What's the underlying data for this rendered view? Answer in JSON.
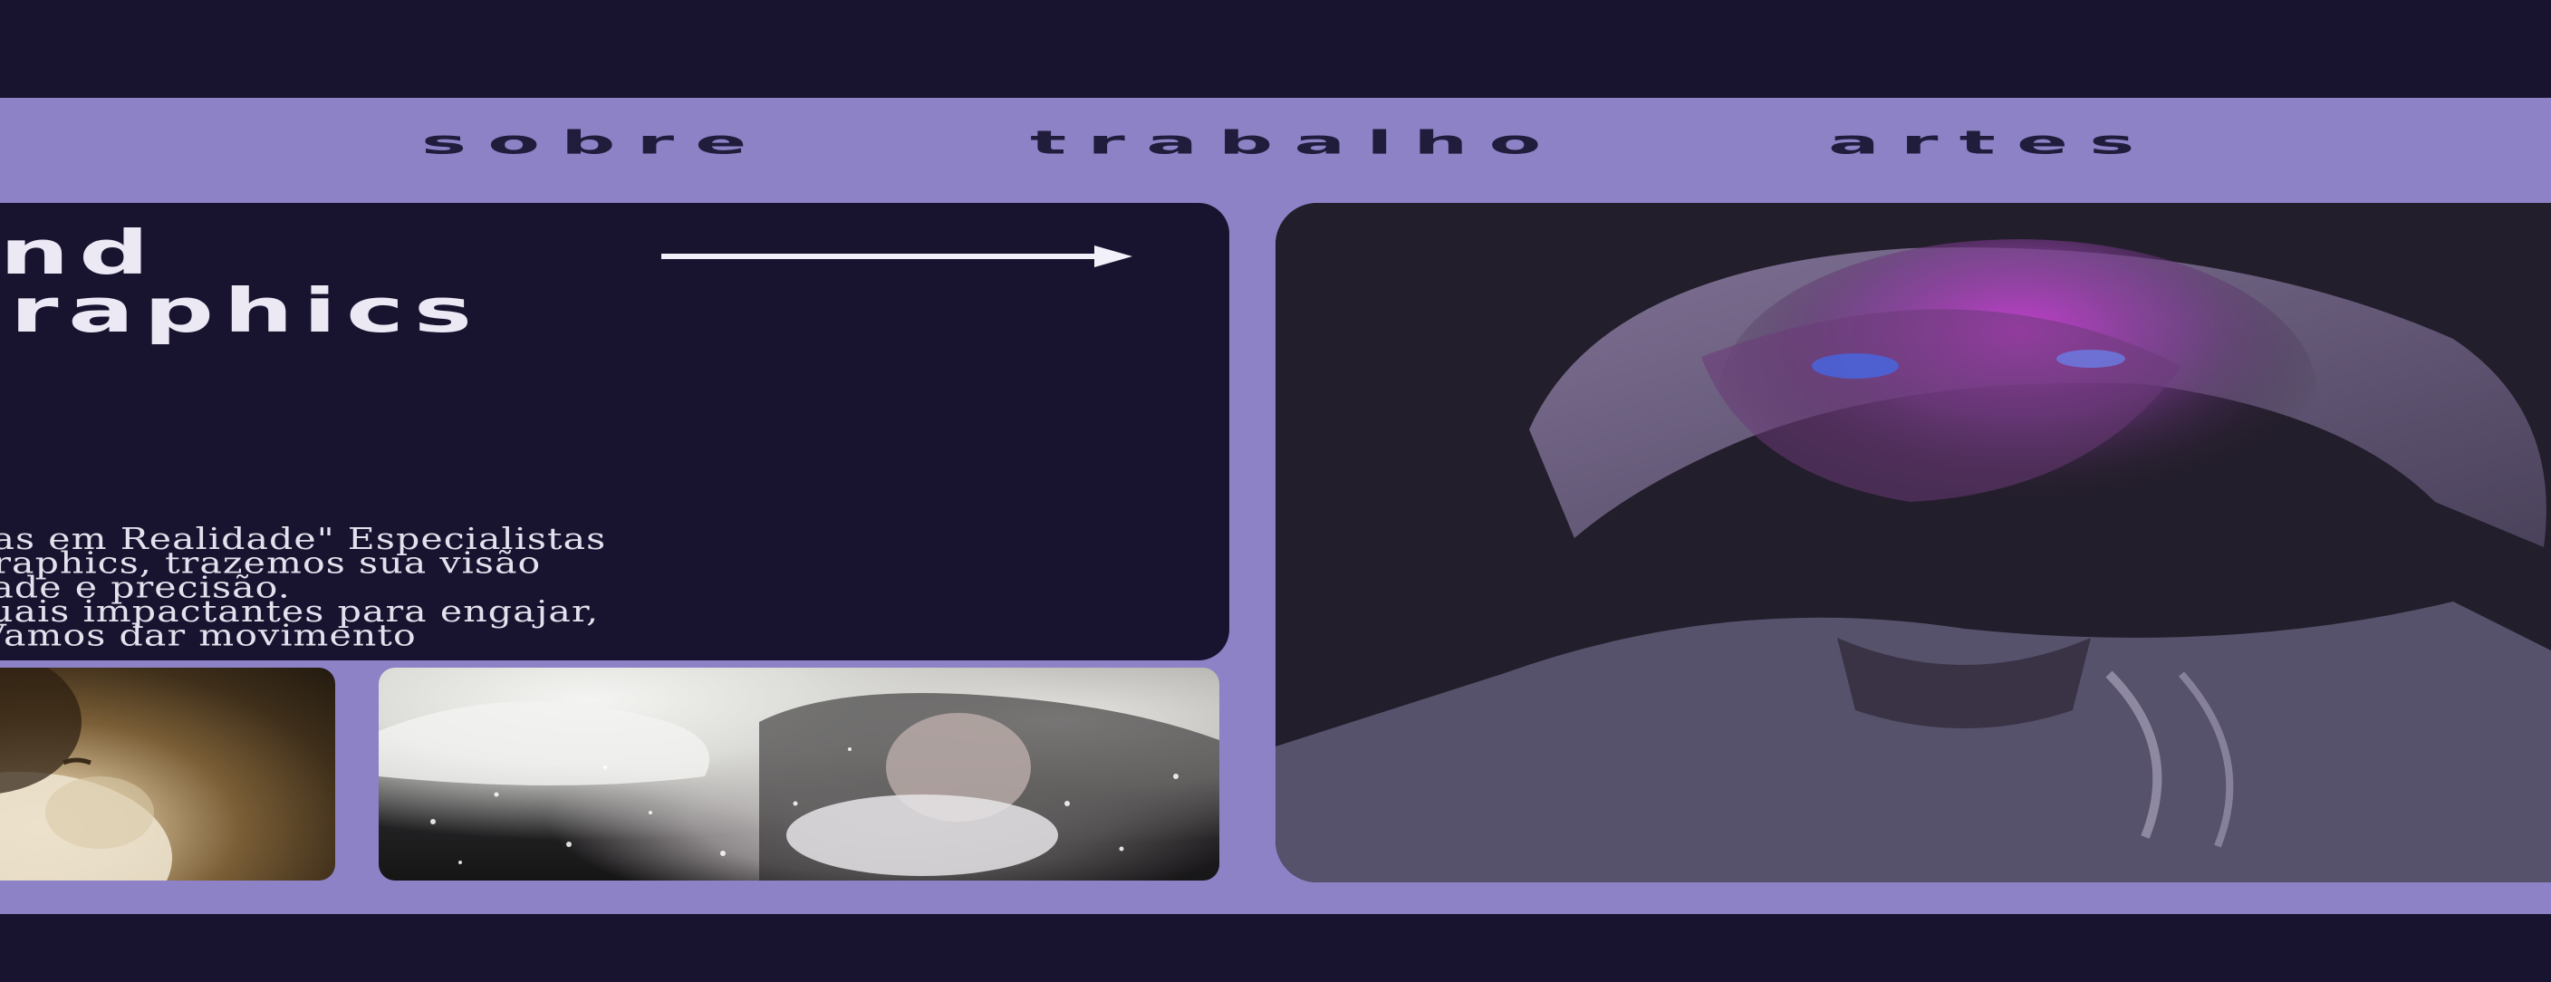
{
  "nav": {
    "links": [
      "sobre",
      "trabalho",
      "artes"
    ]
  },
  "hero": {
    "title_lines": "n and\nn-graphics",
    "arrow_icon": "arrow-right-icon",
    "paragraph": "do Ideias em Realidade\" Especialistas\notion graphics, trazemos sua visão\nginalidade e precisão.\nões visuais impactantes para engajar,\nectar. Vamos dar movimento\nade!"
  },
  "gallery": {
    "thumbs": [
      "portrait-artwork-warm",
      "portrait-artwork-snow"
    ],
    "featured": "portrait-artwork-pink-light"
  },
  "colors": {
    "background": "#181430",
    "panel": "#8c82c5",
    "card": "#181430",
    "nav_text": "#201c3c",
    "light_text": "#ece9f5",
    "accent_pink": "#d23ddc"
  }
}
